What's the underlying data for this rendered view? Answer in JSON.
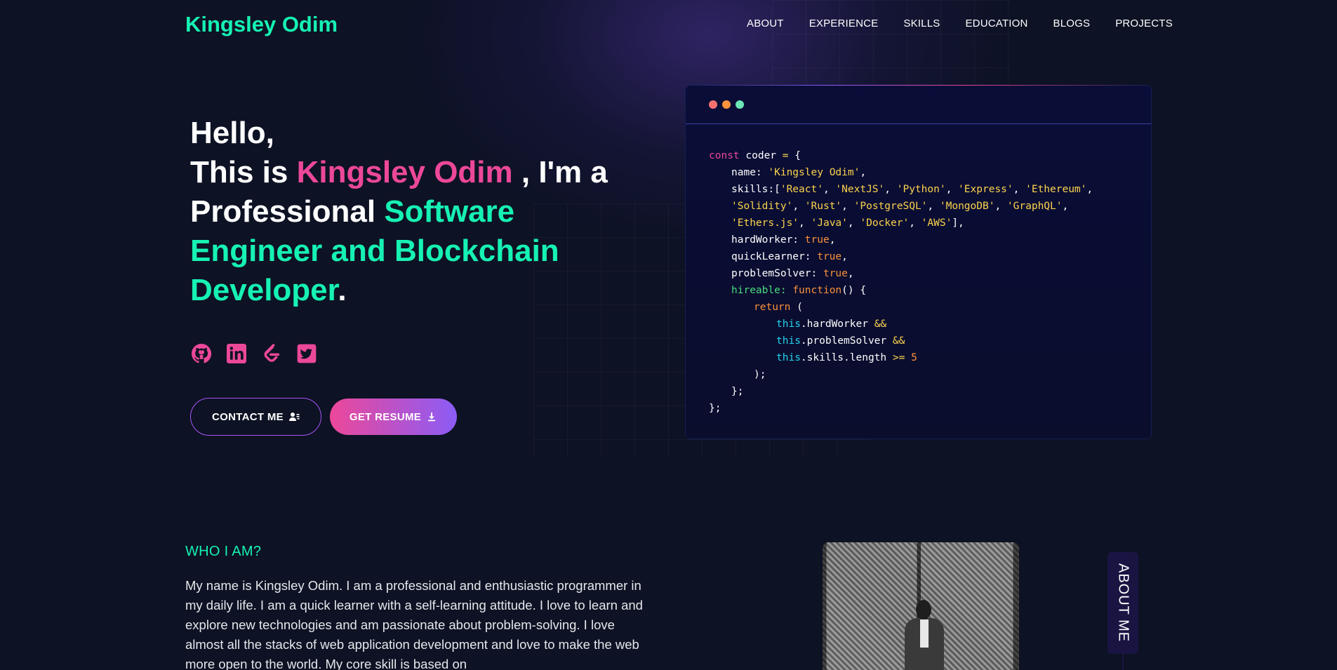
{
  "nav": {
    "logo": "Kingsley Odim",
    "links": [
      "ABOUT",
      "EXPERIENCE",
      "SKILLS",
      "EDUCATION",
      "BLOGS",
      "PROJECTS"
    ]
  },
  "hero": {
    "greeting": "Hello,",
    "this_is": "This is ",
    "name": "Kingsley Odim",
    "im_a": " , I'm a",
    "professional": "Professional ",
    "role": "Software Engineer and Blockchain Developer",
    "period": ".",
    "socials": [
      "github-icon",
      "linkedin-icon",
      "leetcode-icon",
      "twitter-icon"
    ],
    "contact_label": "CONTACT ME",
    "resume_label": "GET RESUME"
  },
  "code_card": {
    "dot_colors": [
      "#f87171",
      "#fb923c",
      "#6ee7b7"
    ],
    "lines": [
      "const coder = {",
      "name: 'Kingsley Odim',",
      "skills:['React', 'NextJS', 'Python', 'Express', 'Ethereum',",
      "'Solidity', 'Rust', 'PostgreSQL', 'MongoDB', 'GraphQL',",
      "'Ethers.js', 'Java', 'Docker', 'AWS'],",
      "hardWorker: true,",
      "quickLearner: true,",
      "problemSolver: true,",
      "hireable: function() {",
      "return (",
      "this.hardWorker &&",
      "this.problemSolver &&",
      "this.skills.length >= 5",
      ");",
      "};",
      "};"
    ]
  },
  "about": {
    "title": "WHO I AM?",
    "text": "My name is Kingsley Odim. I am a professional and enthusiastic programmer in my daily life. I am a quick learner with a self-learning attitude. I love to learn and explore new technologies and am passionate about problem-solving. I love almost all the stacks of web application development and love to make the web more open to the world. My core skill is based on",
    "side_tab": "ABOUT ME"
  },
  "colors": {
    "background": "#0d1224",
    "accent_teal": "#16f2b3",
    "accent_pink": "#ec4899",
    "accent_purple": "#8b5cf6"
  }
}
